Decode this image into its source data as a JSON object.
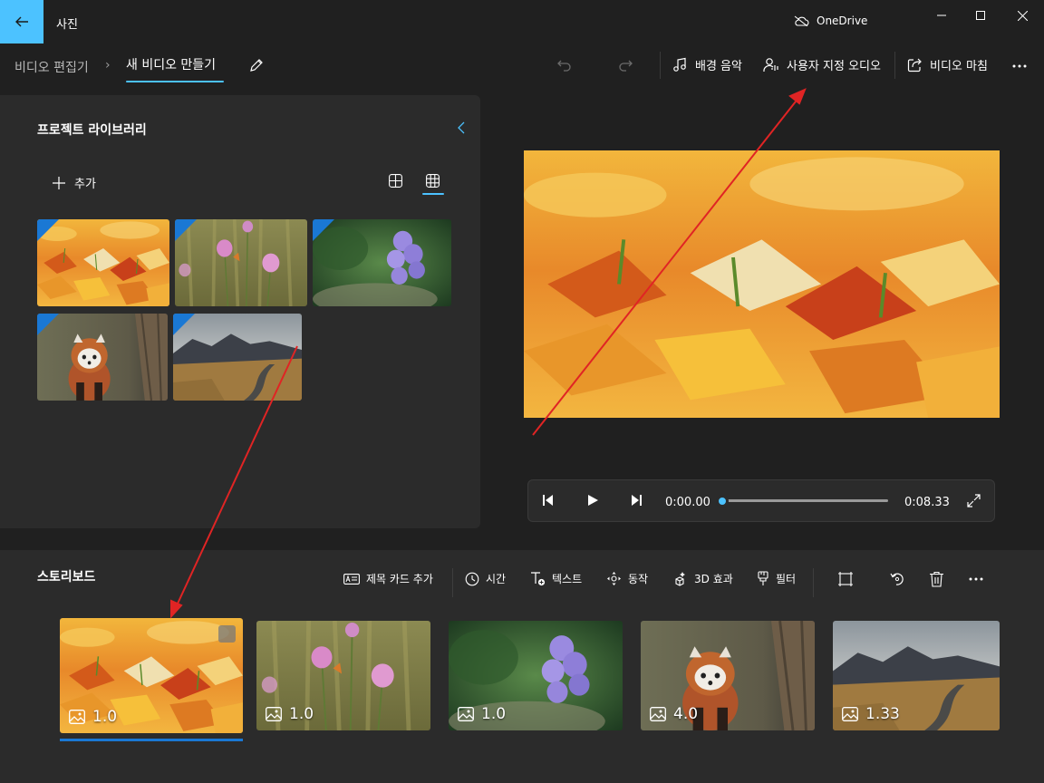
{
  "app": {
    "title": "사진",
    "cloud_label": "OneDrive"
  },
  "breadcrumb": {
    "root": "비디오 편집기",
    "separator": "›",
    "current": "새 비디오 만들기"
  },
  "toolbar": {
    "background_music": "배경 음악",
    "custom_audio": "사용자 지정 오디오",
    "finish_video": "비디오 마침"
  },
  "library": {
    "title": "프로젝트 라이브러리",
    "add_label": "추가"
  },
  "player": {
    "current_time": "0:00.00",
    "total_time": "0:08.33",
    "progress": 0
  },
  "storyboard": {
    "title": "스토리보드",
    "actions": {
      "title_card": "제목 카드 추가",
      "duration": "시간",
      "text": "텍스트",
      "motion": "동작",
      "effects_3d": "3D 효과",
      "filters": "필터"
    },
    "clips": [
      {
        "subject": "autumn leaves",
        "duration": "1.0",
        "selected": true
      },
      {
        "subject": "pink flowers",
        "duration": "1.0",
        "selected": false
      },
      {
        "subject": "purple flower",
        "duration": "1.0",
        "selected": false
      },
      {
        "subject": "red panda",
        "duration": "4.0",
        "selected": false
      },
      {
        "subject": "mountain road",
        "duration": "1.33",
        "selected": false
      }
    ]
  },
  "colors": {
    "accent": "#4cc2ff",
    "selection": "#1a78d4",
    "annotation": "#e02424",
    "background": "#202020",
    "panel": "#2b2b2b"
  }
}
